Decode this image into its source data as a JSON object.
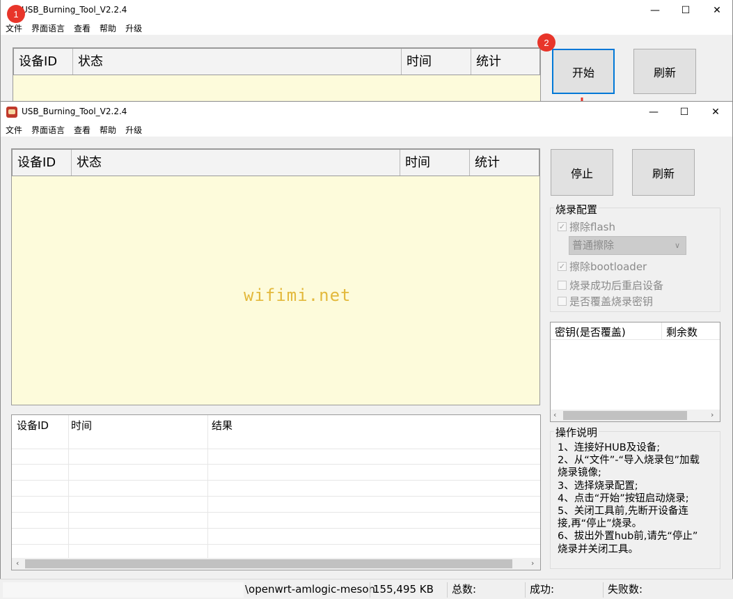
{
  "back_window": {
    "title": "USB_Burning_Tool_V2.2.4",
    "menu": [
      "文件",
      "界面语言",
      "查看",
      "帮助",
      "升级"
    ],
    "columns": [
      "设备ID",
      "状态",
      "时间",
      "统计"
    ],
    "buttons": {
      "start": "开始",
      "refresh": "刷新"
    },
    "badge_1": "1",
    "badge_2": "2"
  },
  "front_window": {
    "title": "USB_Burning_Tool_V2.2.4",
    "menu": [
      "文件",
      "界面语言",
      "查看",
      "帮助",
      "升级"
    ],
    "columns": [
      "设备ID",
      "状态",
      "时间",
      "统计"
    ],
    "buttons": {
      "stop": "停止",
      "refresh": "刷新"
    },
    "watermark": "wifimi.net",
    "log_columns": [
      "设备ID",
      "时间",
      "结果"
    ],
    "config": {
      "title": "烧录配置",
      "erase_flash": "擦除flash",
      "erase_mode": "普通擦除",
      "erase_bootloader": "擦除bootloader",
      "reboot_after": "烧录成功后重启设备",
      "overwrite_key": "是否覆盖烧录密钥"
    },
    "key_columns": [
      "密钥(是否覆盖)",
      "剩余数"
    ],
    "instructions": {
      "title": "操作说明",
      "lines": [
        "1、连接好HUB及设备;",
        "2、从“文件”-“导入烧录包”加载",
        "烧录镜像;",
        "3、选择烧录配置;",
        "4、点击“开始”按钮启动烧录;",
        "5、关闭工具前,先断开设备连",
        "接,再“停止”烧录。",
        "6、拔出外置hub前,请先“停止”",
        "烧录并关闭工具。"
      ]
    },
    "status": {
      "path": "\\openwrt-amlogic-meson",
      "size": "155,495 KB",
      "total": "总数:",
      "success": "成功:",
      "failed": "失败数:"
    }
  },
  "colors": {
    "accent": "#0078d7",
    "badge": "#e8352a",
    "watermark": "#e3b93c",
    "grid_bg": "#fdfbdb"
  }
}
